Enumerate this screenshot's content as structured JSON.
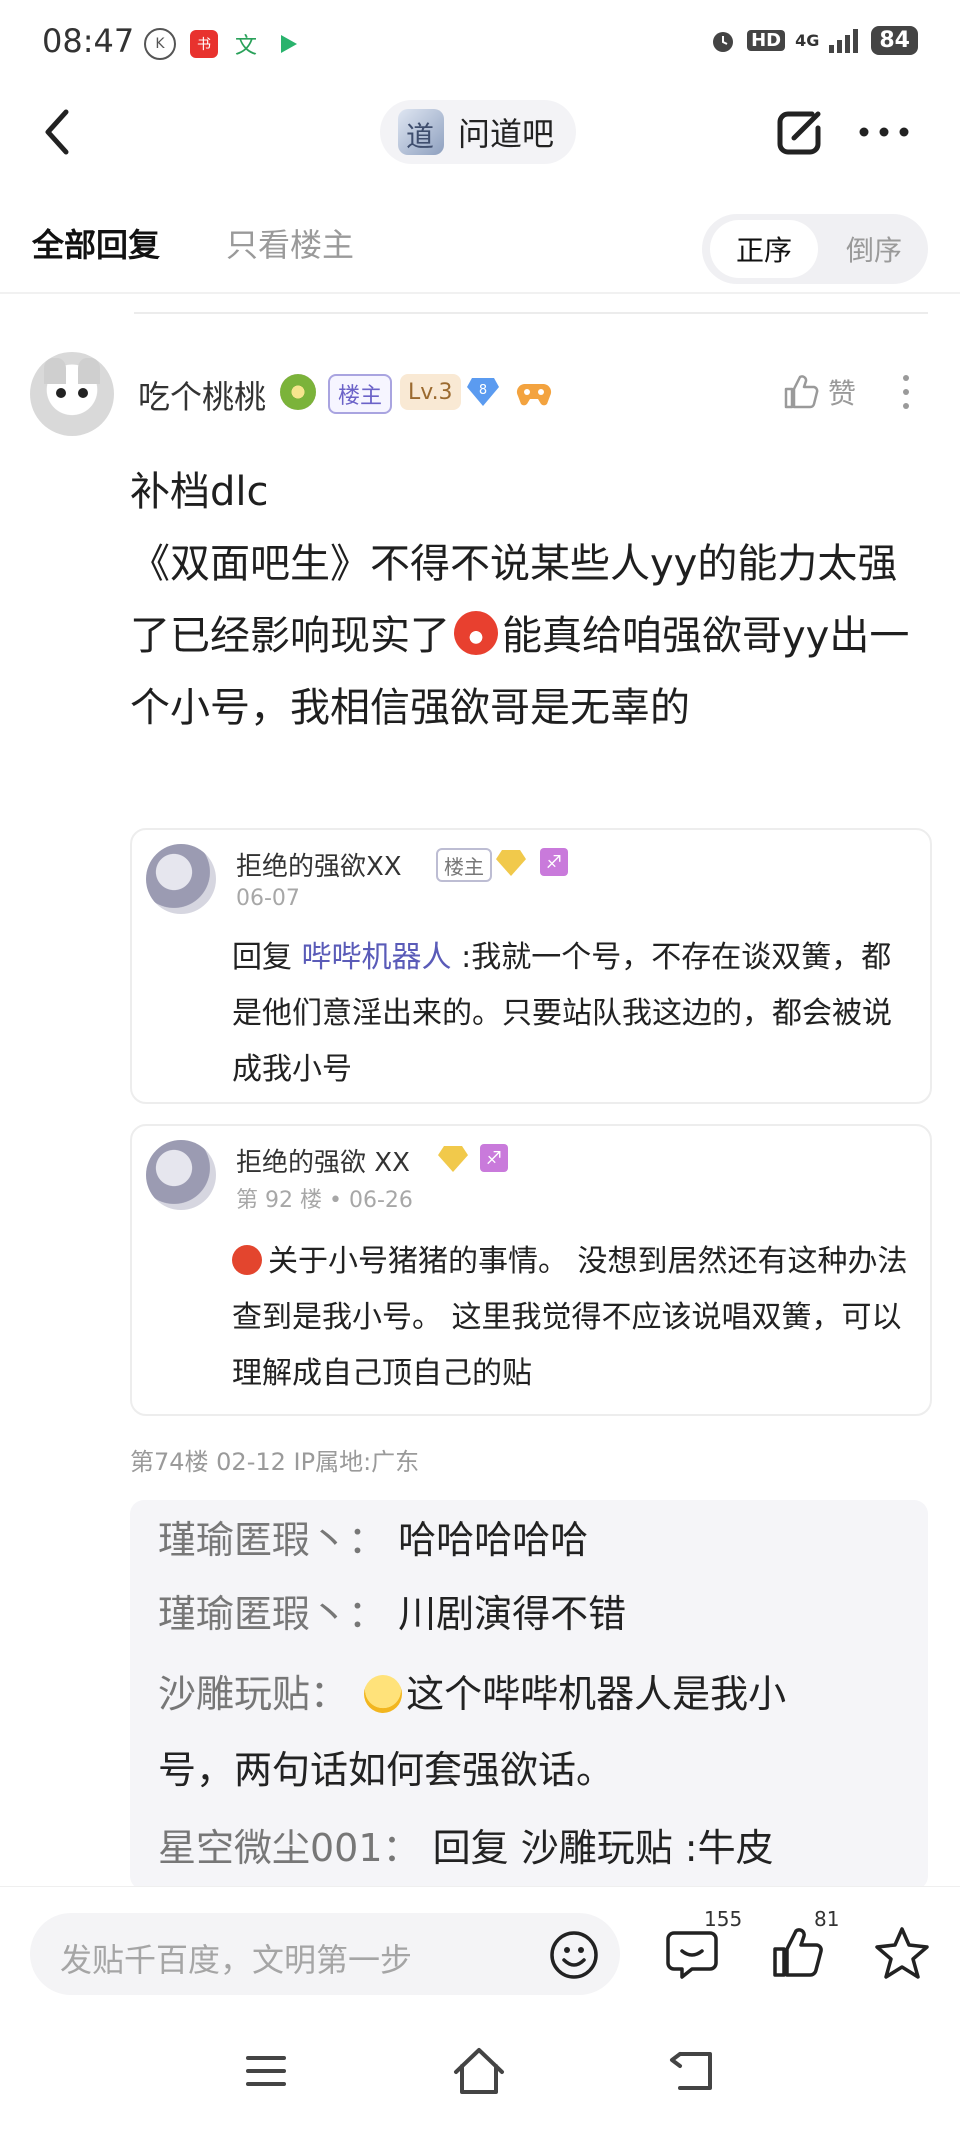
{
  "status_bar": {
    "time": "08:47",
    "icons_left": [
      "k-app-icon",
      "xiaohongshu-icon",
      "translate-icon",
      "play-icon"
    ],
    "hd": "HD",
    "network": "4G",
    "battery": "84"
  },
  "nav": {
    "forum_name": "问道吧"
  },
  "tabs": {
    "all": "全部回复",
    "only_op": "只看楼主",
    "sort_asc": "正序",
    "sort_desc": "倒序"
  },
  "post": {
    "username": "吃个桃桃",
    "badge_op": "楼主",
    "level": "Lv.3",
    "gem_level": "8",
    "like_label": "赞",
    "text_line1": "补档dlc",
    "text_line2_a": "《双面吧生》不得不说某些人yy的能力太强了已经影响现实了",
    "text_line2_b": "能真给咱强欲哥yy出一个小号，我相信强欲哥是无辜的",
    "meta": "第74楼   02-12   IP属地:广东"
  },
  "quote1": {
    "name": "拒绝的强欲XX",
    "badge": "楼主",
    "date": "06-07",
    "reply_prefix": "回复 ",
    "reply_to": "哔哔机器人",
    "text": " :我就一个号，不存在谈双簧，都是他们意淫出来的。只要站队我这边的，都会被说成我小号"
  },
  "quote2": {
    "name": "拒绝的强欲 XX",
    "floor_date": "第 92 楼 • 06-26",
    "text": "关于小号猪猪的事情。 没想到居然还有这种办法查到是我小号。 这里我觉得不应该说唱双簧，可以理解成自己顶自己的贴"
  },
  "replies": [
    {
      "user": "瑾瑜匿瑕丶：",
      "text": "哈哈哈哈哈"
    },
    {
      "user": "瑾瑜匿瑕丶：",
      "text": "川剧演得不错"
    },
    {
      "user": "沙雕玩贴：",
      "text": "这个哔哔机器人是我小号，两句话如何套强欲话。"
    },
    {
      "user": "星空微尘001：",
      "text": "回复 沙雕玩贴 :牛皮"
    }
  ],
  "bottom_bar": {
    "compose_placeholder": "发贴千百度，文明第一步",
    "comment_count": "155",
    "like_count": "81"
  },
  "colors": {
    "accent": "#6b62c8",
    "link": "#5a5bb8",
    "muted": "#9a9a9a"
  }
}
